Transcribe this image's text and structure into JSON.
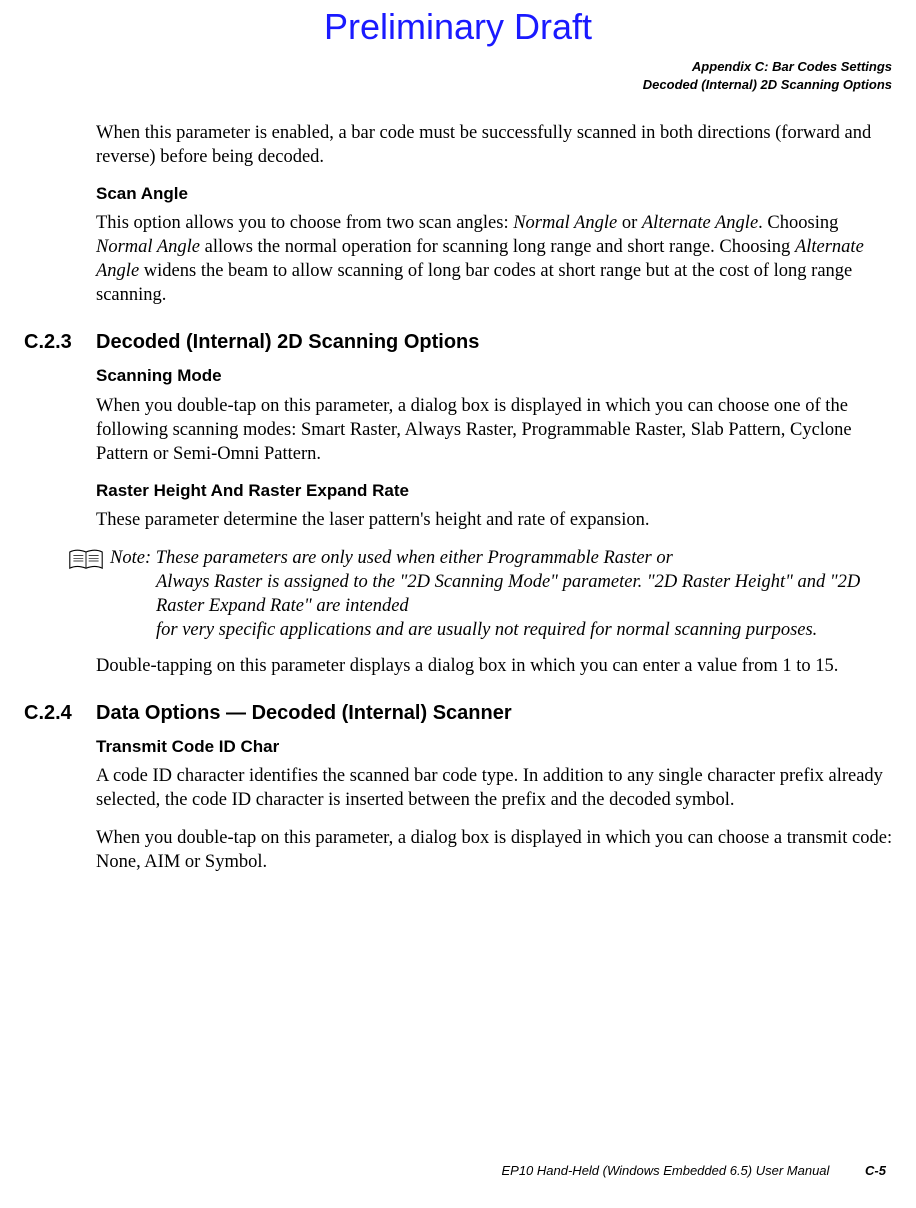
{
  "watermark": "Preliminary Draft",
  "header": {
    "line1": "Appendix C: Bar Codes Settings",
    "line2": "Decoded (Internal) 2D Scanning Options"
  },
  "intro_para": "When this parameter is enabled, a bar code must be successfully scanned in both directions (forward and reverse) before being decoded.",
  "scan_angle": {
    "heading": "Scan Angle",
    "p_before_em1": "This option allows you to choose from two scan angles: ",
    "em1": "Normal Angle",
    "p_between1": " or ",
    "em2": "Alternate Angle",
    "p_after_em2": ". Choosing ",
    "em3": "Normal Angle",
    "p_mid": " allows the normal operation for scanning long range and short range. Choosing ",
    "em4": "Alternate Angle",
    "p_end": " widens the beam to allow scanning of long bar codes at short range but at the cost of long range scanning."
  },
  "section_c23": {
    "num": "C.2.3",
    "title": "Decoded (Internal) 2D Scanning Options",
    "scanning_mode": {
      "heading": "Scanning Mode",
      "para": "When you double-tap on this parameter, a dialog box is displayed in which you can choose one of the following scanning modes: Smart Raster, Always Raster, Programmable Raster, Slab Pattern, Cyclone Pattern or Semi-Omni Pattern."
    },
    "raster": {
      "heading": "Raster Height And Raster Expand Rate",
      "para": "These parameter determine the laser pattern's height and rate of expansion.",
      "note_label": "Note: ",
      "note_text_l1": "These parameters are only used when either Programmable Raster or",
      "note_text_l2": "Always Raster is assigned to the \"2D Scanning Mode\" parameter. \"2D Raster Height\" and \"2D Raster Expand Rate\" are intended",
      "note_text_l3": "for very specific applications and are usually not required for normal scanning purposes.",
      "para2": "Double-tapping on this parameter displays a dialog box in which you can enter a value from 1 to 15."
    }
  },
  "section_c24": {
    "num": "C.2.4",
    "title": "Data Options — Decoded (Internal) Scanner",
    "transmit": {
      "heading": "Transmit Code ID Char",
      "para1": "A code ID character identifies the scanned bar code type. In addition to any single character prefix already selected, the code ID character is inserted between the prefix and the decoded symbol.",
      "para2": "When you double-tap on this parameter, a dialog box is displayed in which you can choose a transmit code: None, AIM or Symbol."
    }
  },
  "footer": {
    "manual": "EP10 Hand-Held (Windows Embedded 6.5) User Manual",
    "page": "C-5"
  }
}
